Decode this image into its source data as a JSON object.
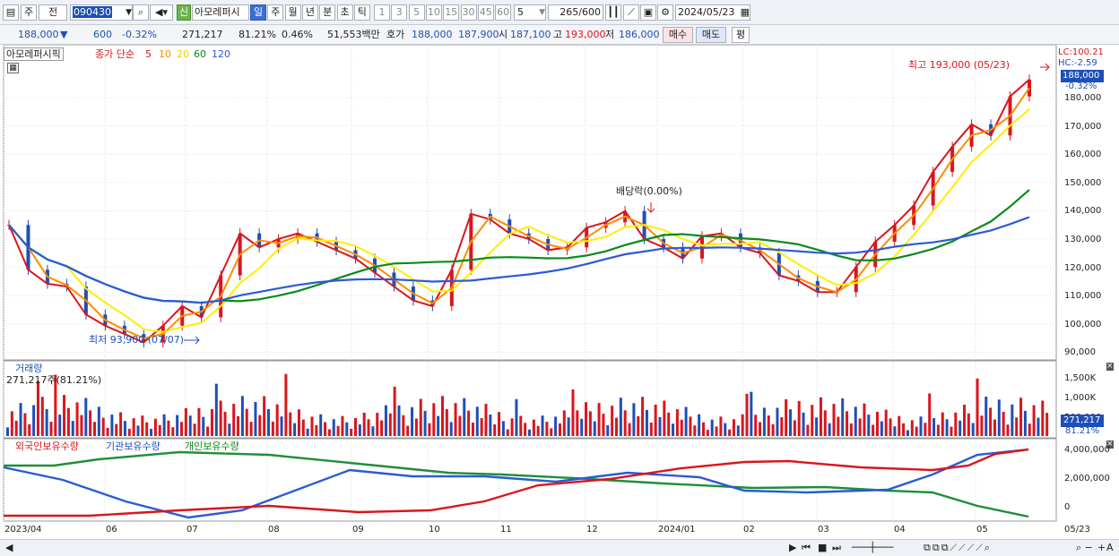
{
  "toolbar": {
    "period_type": "주",
    "market": "전",
    "code": "090430",
    "credit_badge": "신",
    "name": "아모레퍼시",
    "periods": [
      "일",
      "주",
      "월",
      "년",
      "분",
      "초",
      "틱"
    ],
    "active_period": "일",
    "intervals": [
      "1",
      "3",
      "5",
      "10",
      "15",
      "30",
      "45",
      "60"
    ],
    "interval_value": "5",
    "count": "265",
    "count_max": "/600",
    "date": "2024/05/23"
  },
  "quote": {
    "price": "188,000",
    "change": "600",
    "change_pct": "-0.32%",
    "volume": "271,217",
    "volume_ratio": "81.21%",
    "turnover_pct": "0.46%",
    "amount": "51,553백만",
    "ask_label": "호가",
    "ask1": "188,000",
    "ask2": "187,900",
    "open_label": "시",
    "open": "187,100",
    "high_label": "고",
    "high": "193,000",
    "low_label": "저",
    "low": "186,000",
    "buy_button": "매수",
    "sell_button": "매도",
    "eval_button": "평"
  },
  "price_panel": {
    "title": "아모레퍼시픽",
    "ma_label": "종가 단순",
    "ma_periods": [
      "5",
      "10",
      "20",
      "60",
      "120"
    ],
    "ma_colors": [
      "#d9161d",
      "#ff8c00",
      "#ffee00",
      "#0a8a1a",
      "#2a5bd7"
    ],
    "lc": "LC:100.21",
    "hc": "HC:-2.59",
    "current": "188,000",
    "current_pct": "-0.32%",
    "high_note": "최고 193,000 (05/23)",
    "low_note": "최저 93,900 (07/07)",
    "dividend_note": "배당락(0.00%)",
    "y_ticks": [
      "180,000",
      "170,000",
      "160,000",
      "150,000",
      "140,000",
      "130,000",
      "120,000",
      "110,000",
      "100,000",
      "90,000"
    ]
  },
  "volume_panel": {
    "title": "거래량",
    "value": "271,217주(81.21%)",
    "ticks": [
      "1,500K",
      "1,000K",
      "500,000"
    ],
    "current": "271,217",
    "current_pct": "81.21%"
  },
  "holding_panel": {
    "labels": [
      "외국인보유수량",
      "기관보유수량",
      "개인보유수량"
    ],
    "ticks": [
      "4,000,000",
      "2,000,000",
      "0"
    ]
  },
  "x_axis": [
    "2023/04",
    "06",
    "07",
    "08",
    "09",
    "10",
    "11",
    "12",
    "2024/01",
    "02",
    "03",
    "04",
    "05",
    "05/23"
  ],
  "chart_data": {
    "type": "line",
    "price_series": [
      {
        "name": "5",
        "closes": [
          136000,
          120000,
          115000,
          114000,
          104000,
          100000,
          97000,
          94000,
          100000,
          107000,
          103000,
          118000,
          133000,
          128000,
          131000,
          133000,
          130000,
          127000,
          124000,
          119000,
          114000,
          109000,
          107000,
          120000,
          140000,
          138000,
          133000,
          131000,
          127000,
          128000,
          135000,
          137000,
          141000,
          131000,
          128000,
          124000,
          132000,
          133000,
          128000,
          126000,
          118000,
          116000,
          112000,
          112000,
          121000,
          130000,
          136000,
          143000,
          155000,
          164000,
          172000,
          168000,
          182000,
          188000
        ]
      }
    ],
    "x_ticks": [
      "2023/04",
      "06",
      "07",
      "08",
      "09",
      "10",
      "11",
      "12",
      "2024/01",
      "02",
      "03",
      "04",
      "05"
    ],
    "y_range": [
      90000,
      195000
    ]
  }
}
